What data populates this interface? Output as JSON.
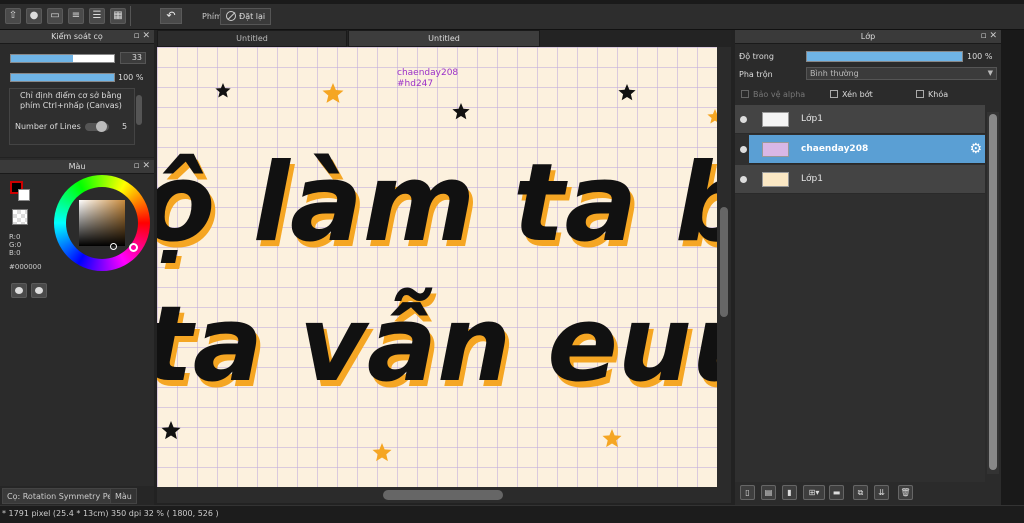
{
  "toolbar": {
    "shortcut_label": "Phím",
    "reset_label": "Đặt lại",
    "icons": [
      "upload-icon",
      "speech-icon",
      "comment-icon",
      "document-icon",
      "list-icon",
      "grid-icon",
      "undo-icon",
      "reset-icon"
    ]
  },
  "brush_panel": {
    "title": "Kiểm soát cọ",
    "size_value": "33",
    "size_fill": 0.6,
    "opacity_value": "100 %",
    "opacity_fill": 1.0,
    "description": "Chỉ định điểm cơ sở bằng phím Ctrl+nhấp (Canvas)",
    "lines_label": "Number of Lines",
    "lines_value": "5"
  },
  "color_panel": {
    "title": "Màu",
    "r": "R:0",
    "g": "G:0",
    "b": "B:0",
    "hex": "#000000",
    "colors": {
      "foreground": "#000000",
      "background": "#ffffff",
      "hue": "#f5a623"
    }
  },
  "panel_tabs": [
    "Cọ: Rotation Symmetry Pen",
    "Màu"
  ],
  "doc_tabs": [
    "Untitled",
    "Untitled"
  ],
  "canvas": {
    "watermark_name": "chaenday208",
    "watermark_tag": "#hd247",
    "line1": "ộ làm ta buồ",
    "line2": "ta vẫn euu",
    "colors": {
      "background": "#fcf1de",
      "text": "#111111",
      "shadow": "#f5a623",
      "star_dark": "#111111",
      "star_gold": "#f5a623"
    }
  },
  "layer_panel": {
    "title": "Lớp",
    "opacity_label": "Độ trong",
    "opacity_value": "100 %",
    "blend_label": "Pha trộn",
    "blend_value": "Bình thường",
    "protect_alpha": "Bảo vệ alpha",
    "clipping": "Xén bớt",
    "lock": "Khóa",
    "layers": [
      {
        "name": "Lớp1",
        "selected": false
      },
      {
        "name": "chaenday208",
        "selected": true
      },
      {
        "name": "Lớp1",
        "selected": false
      }
    ],
    "accent": "#5a9fd4"
  },
  "statusbar": {
    "text": "* 1791 pixel   (25.4 * 13cm)   350 dpi   32 %   ( 1800, 526 )"
  }
}
